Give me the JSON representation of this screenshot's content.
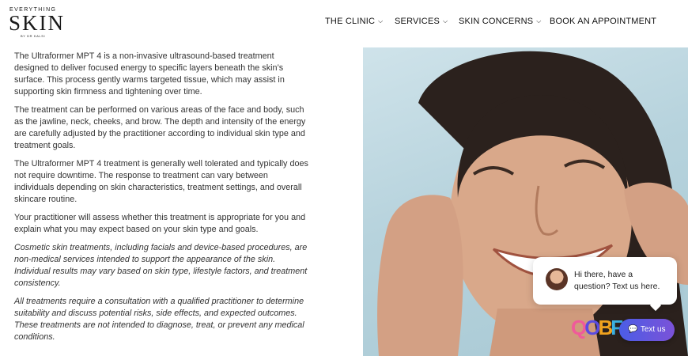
{
  "logo": {
    "top": "EVERYTHING",
    "main": "SKIN",
    "sub": "BY DR KALSI"
  },
  "nav": [
    {
      "label": "THE CLINIC",
      "dropdown": true
    },
    {
      "label": "SERVICES",
      "dropdown": true
    },
    {
      "label": "SKIN CONCERNS",
      "dropdown": true
    },
    {
      "label": "BOOK AN APPOINTMENT",
      "dropdown": false
    }
  ],
  "content": {
    "paragraphs": [
      "The Ultraformer MPT 4 is a non-invasive ultrasound-based treatment designed to deliver focused energy to specific layers beneath the skin’s surface. This process gently warms targeted tissue, which may assist in supporting skin firmness and tightening over time.",
      "The treatment can be performed on various areas of the face and body, such as the jawline, neck, cheeks, and brow. The depth and intensity of the energy are carefully adjusted by the practitioner according to individual skin type and treatment goals.",
      "The Ultraformer MPT 4 treatment is generally well tolerated and typically does not require downtime. The response to treatment can vary between individuals depending on skin characteristics, treatment settings, and overall skincare routine.",
      "Your practitioner will assess whether this treatment is appropriate for you and explain what you may expect based on your skin type and goals."
    ],
    "disclaimers": [
      "Cosmetic skin treatments, including facials and device-based procedures, are non-medical services intended to support the appearance of the skin. Individual results may vary based on skin type, lifestyle factors, and treatment consistency.",
      "All treatments require a consultation with a qualified practitioner to determine suitability and discuss potential risks, side effects, and expected outcomes. These treatments are not intended to diagnose, treat, or prevent any medical conditions."
    ]
  },
  "chat": {
    "message": "Hi there, have a question? Text us here."
  },
  "textus": {
    "label": "Text us"
  },
  "colors": {
    "accent": "#5a5ce0",
    "hero_bg": "#b7d3dd"
  }
}
